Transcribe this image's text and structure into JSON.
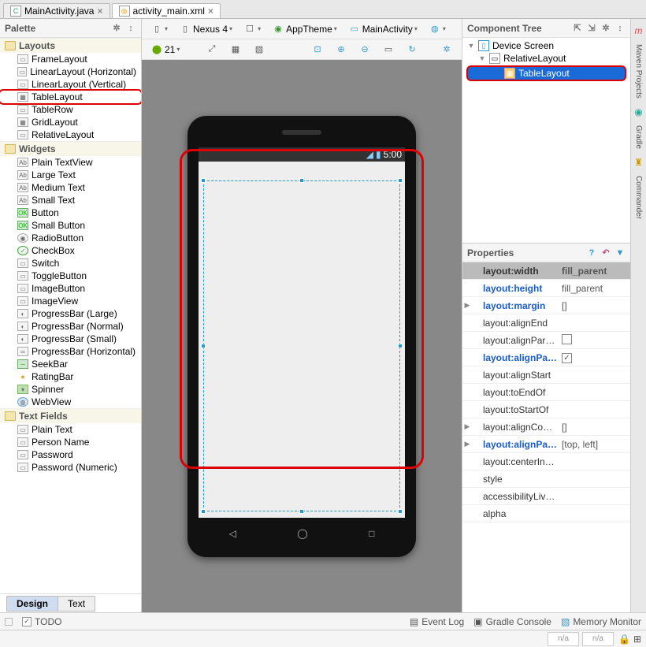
{
  "tabs": [
    {
      "icon": "C",
      "label": "MainActivity.java",
      "active": false
    },
    {
      "icon": "◎",
      "label": "activity_main.xml",
      "active": true
    }
  ],
  "palette": {
    "title": "Palette",
    "groups": [
      {
        "name": "Layouts",
        "items": [
          {
            "label": "FrameLayout",
            "icon": "▭"
          },
          {
            "label": "LinearLayout (Horizontal)",
            "icon": "▭"
          },
          {
            "label": "LinearLayout (Vertical)",
            "icon": "▭"
          },
          {
            "label": "TableLayout",
            "icon": "▦",
            "highlight": true
          },
          {
            "label": "TableRow",
            "icon": "▭"
          },
          {
            "label": "GridLayout",
            "icon": "▦"
          },
          {
            "label": "RelativeLayout",
            "icon": "▭"
          }
        ]
      },
      {
        "name": "Widgets",
        "items": [
          {
            "label": "Plain TextView",
            "icon": "Ab"
          },
          {
            "label": "Large Text",
            "icon": "Ab"
          },
          {
            "label": "Medium Text",
            "icon": "Ab"
          },
          {
            "label": "Small Text",
            "icon": "Ab"
          },
          {
            "label": "Button",
            "icon": "OK",
            "cls": "ok"
          },
          {
            "label": "Small Button",
            "icon": "OK",
            "cls": "ok"
          },
          {
            "label": "RadioButton",
            "icon": "◉",
            "cls": "radio"
          },
          {
            "label": "CheckBox",
            "icon": "✓",
            "cls": "check"
          },
          {
            "label": "Switch",
            "icon": "▭"
          },
          {
            "label": "ToggleButton",
            "icon": "▭"
          },
          {
            "label": "ImageButton",
            "icon": "▭"
          },
          {
            "label": "ImageView",
            "icon": "▭"
          },
          {
            "label": "ProgressBar (Large)",
            "icon": "◐"
          },
          {
            "label": "ProgressBar (Normal)",
            "icon": "◐"
          },
          {
            "label": "ProgressBar (Small)",
            "icon": "◐"
          },
          {
            "label": "ProgressBar (Horizontal)",
            "icon": "═"
          },
          {
            "label": "SeekBar",
            "icon": "─",
            "cls": "ok"
          },
          {
            "label": "RatingBar",
            "icon": "★",
            "cls": "star"
          },
          {
            "label": "Spinner",
            "icon": "▾",
            "cls": "spin"
          },
          {
            "label": "WebView",
            "icon": "◍",
            "cls": "web"
          }
        ]
      },
      {
        "name": "Text Fields",
        "items": [
          {
            "label": "Plain Text",
            "icon": "▭"
          },
          {
            "label": "Person Name",
            "icon": "▭"
          },
          {
            "label": "Password",
            "icon": "▭"
          },
          {
            "label": "Password (Numeric)",
            "icon": "▭"
          }
        ]
      }
    ]
  },
  "toolbar": {
    "device": "Nexus 4",
    "theme": "AppTheme",
    "activity": "MainActivity",
    "api": "21"
  },
  "status_time": "5:00",
  "component_tree": {
    "title": "Component Tree",
    "root": "Device Screen",
    "relative": "RelativeLayout",
    "table": "TableLayout"
  },
  "properties": {
    "title": "Properties",
    "rows": [
      {
        "k": "layout:width",
        "v": "fill_parent",
        "hdr": true
      },
      {
        "k": "layout:height",
        "v": "fill_parent",
        "blue": true
      },
      {
        "k": "layout:margin",
        "v": "[]",
        "exp": true,
        "blue": true
      },
      {
        "k": "layout:alignEnd",
        "v": ""
      },
      {
        "k": "layout:alignParentEnd",
        "v": "",
        "check": "empty"
      },
      {
        "k": "layout:alignParentStart",
        "v": "",
        "check": "checked",
        "blue": true
      },
      {
        "k": "layout:alignStart",
        "v": ""
      },
      {
        "k": "layout:toEndOf",
        "v": ""
      },
      {
        "k": "layout:toStartOf",
        "v": ""
      },
      {
        "k": "layout:alignComponent",
        "v": "[]",
        "exp": true
      },
      {
        "k": "layout:alignParent",
        "v": "[top, left]",
        "exp": true,
        "blue": true
      },
      {
        "k": "layout:centerInParent",
        "v": ""
      },
      {
        "k": "style",
        "v": ""
      },
      {
        "k": "accessibilityLiveRegion",
        "v": ""
      },
      {
        "k": "alpha",
        "v": ""
      }
    ]
  },
  "design_tabs": {
    "design": "Design",
    "text": "Text"
  },
  "status": {
    "todo": "TODO",
    "eventlog": "Event Log",
    "gradle": "Gradle Console",
    "memory": "Memory Monitor",
    "na": "n/a"
  },
  "side_tabs": {
    "maven": "Maven Projects",
    "gradle": "Gradle",
    "commander": "Commander"
  }
}
